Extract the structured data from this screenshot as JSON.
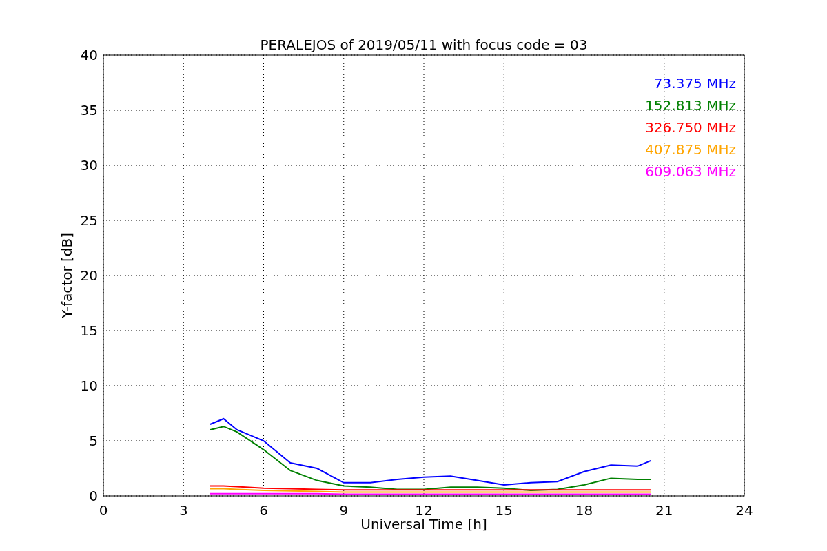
{
  "chart_data": {
    "type": "line",
    "title": "PERALEJOS of 2019/05/11 with focus code = 03",
    "xlabel": "Universal Time [h]",
    "ylabel": "Y-factor [dB]",
    "x": [
      4,
      4.5,
      5,
      6,
      7,
      8,
      9,
      10,
      11,
      12,
      13,
      14,
      15,
      16,
      17,
      18,
      19,
      20,
      20.5
    ],
    "series": [
      {
        "name": "73.375 MHz",
        "color": "#0000ff",
        "values": [
          6.5,
          7,
          6,
          5,
          3,
          2.5,
          1.2,
          1.2,
          1.5,
          1.7,
          1.8,
          1.4,
          1,
          1.2,
          1.3,
          2.2,
          2.8,
          2.7,
          3.2
        ]
      },
      {
        "name": "152.813 MHz",
        "color": "#008000",
        "values": [
          6,
          6.3,
          5.8,
          4.2,
          2.3,
          1.4,
          0.9,
          0.8,
          0.6,
          0.6,
          0.8,
          0.8,
          0.7,
          0.5,
          0.6,
          1,
          1.6,
          1.5,
          1.5
        ]
      },
      {
        "name": "326.750 MHz",
        "color": "#ff0000",
        "values": [
          0.9,
          0.9,
          0.85,
          0.7,
          0.65,
          0.6,
          0.55,
          0.55,
          0.55,
          0.55,
          0.55,
          0.55,
          0.55,
          0.55,
          0.55,
          0.55,
          0.55,
          0.55,
          0.55
        ]
      },
      {
        "name": "407.875 MHz",
        "color": "#ffa500",
        "values": [
          0.65,
          0.65,
          0.6,
          0.5,
          0.45,
          0.4,
          0.35,
          0.35,
          0.35,
          0.35,
          0.35,
          0.35,
          0.35,
          0.35,
          0.35,
          0.35,
          0.35,
          0.35,
          0.35
        ]
      },
      {
        "name": "609.063 MHz",
        "color": "#ff00ff",
        "values": [
          0.2,
          0.2,
          0.2,
          0.2,
          0.2,
          0.2,
          0.15,
          0.15,
          0.15,
          0.15,
          0.15,
          0.15,
          0.15,
          0.15,
          0.15,
          0.15,
          0.15,
          0.15,
          0.15
        ]
      }
    ],
    "grid": true,
    "xlim": [
      0,
      24
    ],
    "ylim": [
      0,
      40
    ],
    "xticks": [
      0,
      3,
      6,
      9,
      12,
      15,
      18,
      21,
      24
    ],
    "yticks": [
      0,
      5,
      10,
      15,
      20,
      25,
      30,
      35,
      40
    ]
  }
}
